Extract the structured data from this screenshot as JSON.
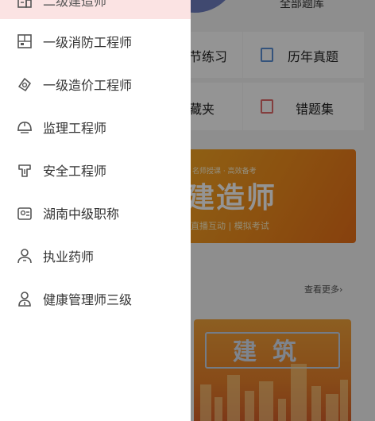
{
  "background": {
    "header_text": "全部题库",
    "tiles": [
      {
        "label": "章节练习",
        "visible_label": "节练习",
        "icon": "book-icon",
        "color": "#5a8fd6"
      },
      {
        "label": "历年真题",
        "icon": "exam-paper-icon",
        "color": "#5a8fd6"
      },
      {
        "label": "我的收藏夹",
        "visible_label": "藏夹",
        "icon": "star-icon",
        "color": "#e8a23b"
      },
      {
        "label": "错题集",
        "icon": "wrong-book-icon",
        "color": "#e26b6b"
      }
    ],
    "banner": {
      "top_text": "名师授课 · 高效备考",
      "title": "建造师",
      "subtitle": "直播互动 | 模拟考试"
    },
    "more_link": "查看更多›",
    "card": {
      "title": "建筑"
    }
  },
  "drawer": {
    "items": [
      {
        "label": "二级建造师",
        "icon": "building-icon",
        "selected": true
      },
      {
        "label": "一级消防工程师",
        "icon": "fire-protection-icon",
        "selected": false
      },
      {
        "label": "一级造价工程师",
        "icon": "cost-estimate-icon",
        "selected": false
      },
      {
        "label": "监理工程师",
        "icon": "helmet-icon",
        "selected": false
      },
      {
        "label": "安全工程师",
        "icon": "safety-shield-icon",
        "selected": false
      },
      {
        "label": "湖南中级职称",
        "icon": "certificate-icon",
        "selected": false
      },
      {
        "label": "执业药师",
        "icon": "pharmacist-icon",
        "selected": false
      },
      {
        "label": "健康管理师三级",
        "icon": "health-manager-icon",
        "selected": false
      }
    ]
  },
  "colors": {
    "selected_bg": "#fbe3e3",
    "overlay": "rgba(0,0,0,0.42)",
    "banner_orange": "#f08a1c"
  }
}
